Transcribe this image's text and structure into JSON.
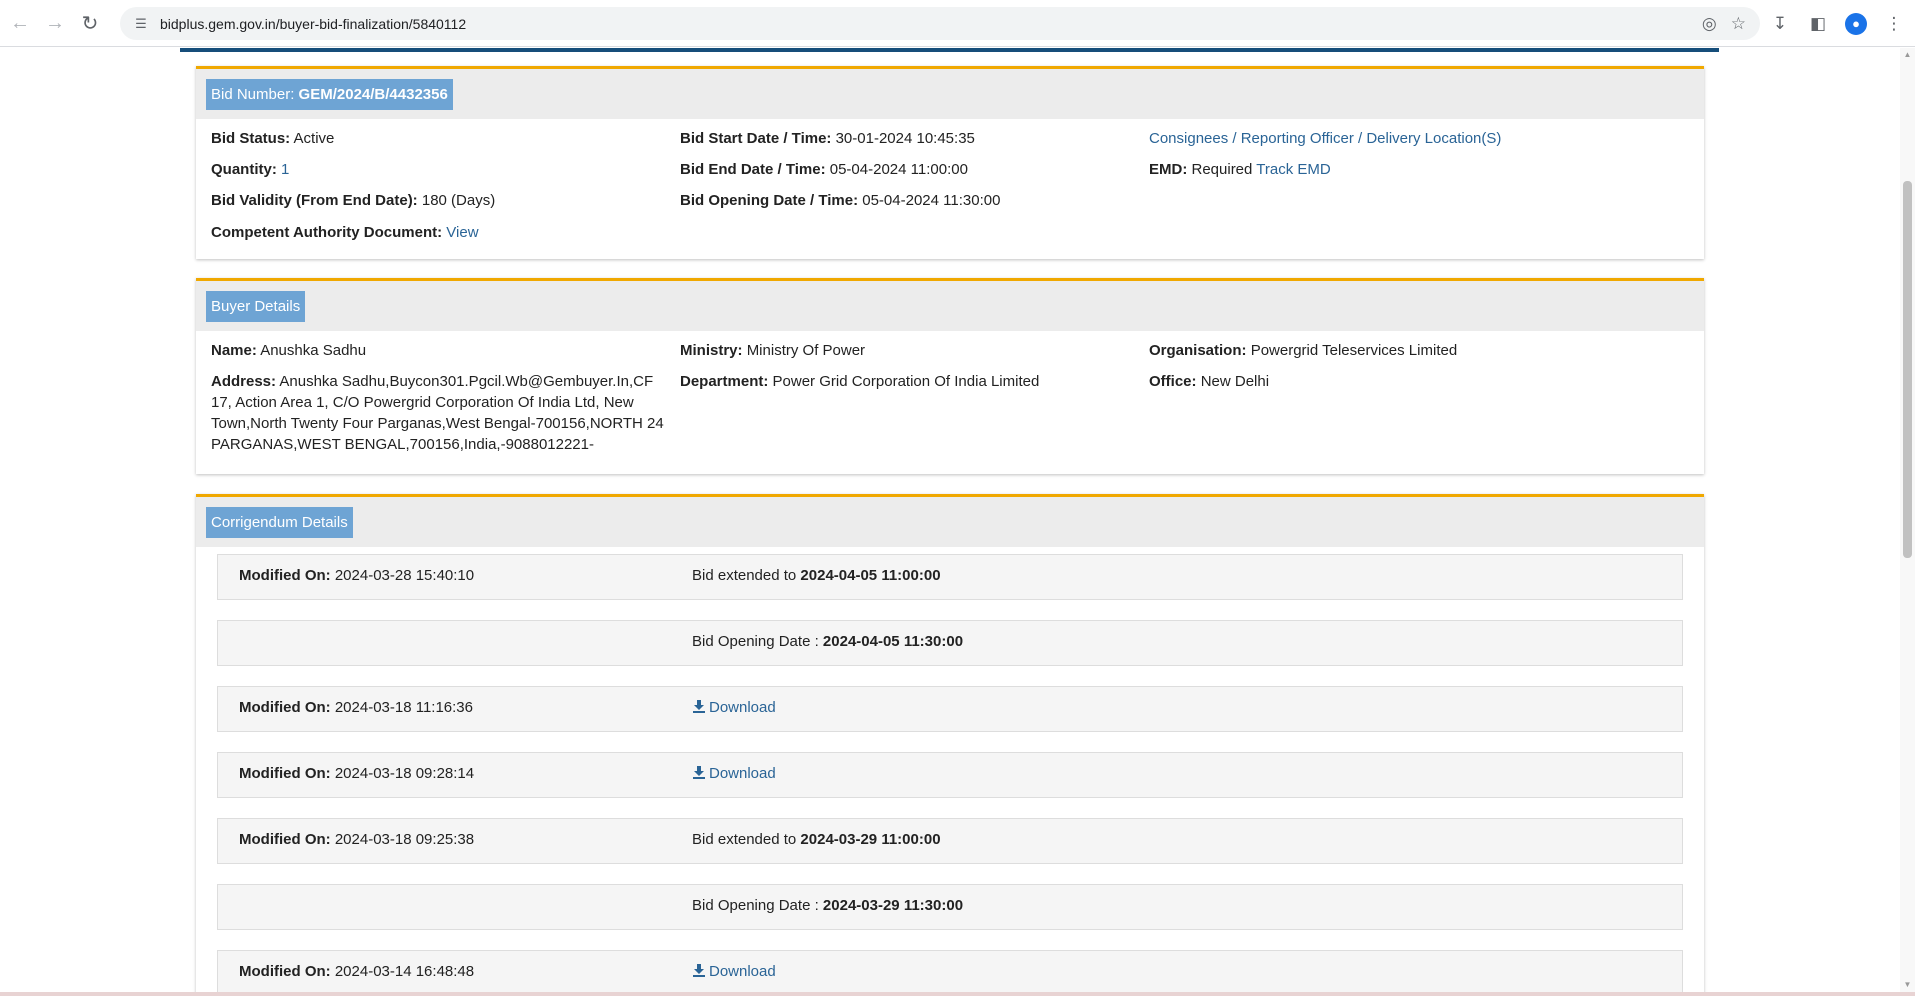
{
  "browser": {
    "url": "bidplus.gem.gov.in/buyer-bid-finalization/5840112",
    "avatar_initial": "●"
  },
  "bid": {
    "title_prefix": "Bid Number: ",
    "bid_number": "GEM/2024/B/4432356",
    "status_label": "Bid Status:",
    "status_value": "Active",
    "quantity_label": "Quantity:",
    "quantity_value": "1",
    "validity_label": "Bid Validity (From End Date):",
    "validity_value": "180 (Days)",
    "cad_label": "Competent Authority Document:",
    "cad_link": "View",
    "start_label": "Bid Start Date / Time:",
    "start_value": "30-01-2024 10:45:35",
    "end_label": "Bid End Date / Time:",
    "end_value": "05-04-2024 11:00:00",
    "opening_label": "Bid Opening Date / Time:",
    "opening_value": "05-04-2024 11:30:00",
    "consignees_link": "Consignees / Reporting Officer / Delivery Location(S)",
    "emd_label": "EMD:",
    "emd_value": "Required",
    "emd_link": "Track EMD"
  },
  "buyer": {
    "title": "Buyer Details",
    "name_label": "Name:",
    "name_value": "Anushka Sadhu",
    "address_label": "Address:",
    "address_value": "Anushka Sadhu,Buycon301.Pgcil.Wb@Gembuyer.In,CF 17, Action Area 1, C/O Powergrid Corporation Of India Ltd, New Town,North Twenty Four Parganas,West Bengal-700156,NORTH 24 PARGANAS,WEST BENGAL,700156,India,-9088012221-",
    "ministry_label": "Ministry:",
    "ministry_value": "Ministry Of Power",
    "department_label": "Department:",
    "department_value": "Power Grid Corporation Of India Limited",
    "organisation_label": "Organisation:",
    "organisation_value": "Powergrid Teleservices Limited",
    "office_label": "Office:",
    "office_value": "New Delhi"
  },
  "corrigendum": {
    "title": "Corrigendum Details",
    "modified_label": "Modified On:",
    "rows": [
      {
        "modified": "2024-03-28 15:40:10",
        "text": "Bid extended to ",
        "bold": "2024-04-05 11:00:00"
      },
      {
        "modified": "",
        "text": "Bid Opening Date : ",
        "bold": "2024-04-05 11:30:00"
      },
      {
        "modified": "2024-03-18 11:16:36",
        "download": "Download"
      },
      {
        "modified": "2024-03-18 09:28:14",
        "download": "Download"
      },
      {
        "modified": "2024-03-18 09:25:38",
        "text": "Bid extended to ",
        "bold": "2024-03-29 11:00:00"
      },
      {
        "modified": "",
        "text": "Bid Opening Date : ",
        "bold": "2024-03-29 11:30:00"
      },
      {
        "modified": "2024-03-14 16:48:48",
        "download": "Download"
      }
    ]
  }
}
